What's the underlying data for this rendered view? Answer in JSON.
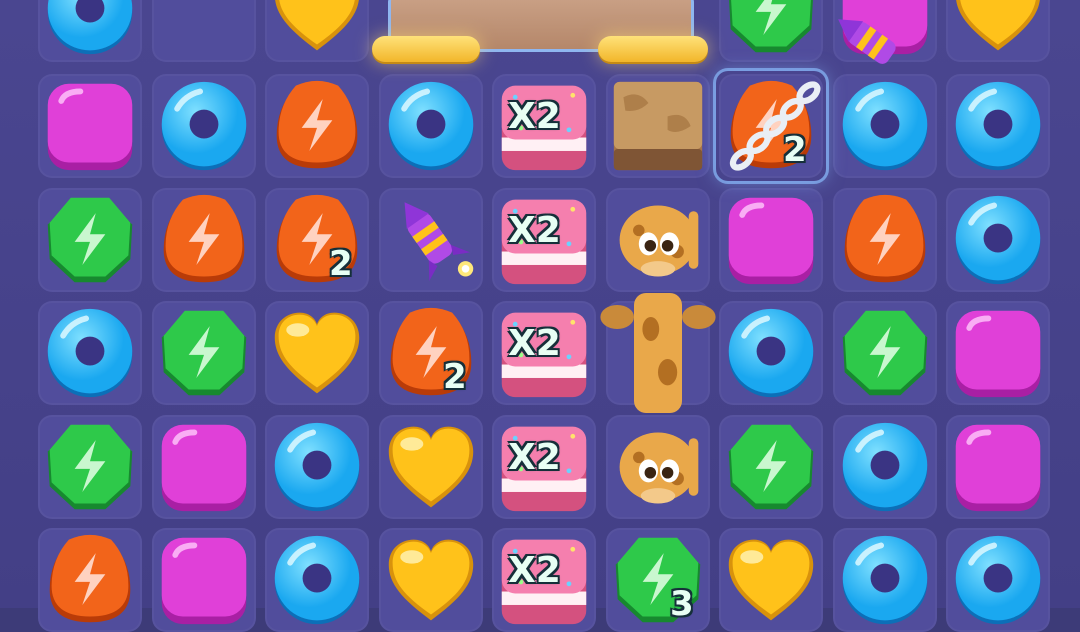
{
  "board": {
    "cells": [
      {
        "c": 0,
        "r": 0,
        "type": "donut"
      },
      {
        "c": 1,
        "r": 0,
        "type": "empty"
      },
      {
        "c": 2,
        "r": 0,
        "type": "heart"
      },
      {
        "c": 3,
        "r": 0,
        "type": "chute"
      },
      {
        "c": 4,
        "r": 0,
        "type": "chute"
      },
      {
        "c": 5,
        "r": 0,
        "type": "chute"
      },
      {
        "c": 6,
        "r": 0,
        "type": "bolt-green"
      },
      {
        "c": 7,
        "r": 0,
        "type": "square"
      },
      {
        "c": 8,
        "r": 0,
        "type": "heart"
      },
      {
        "c": 0,
        "r": 1,
        "type": "square"
      },
      {
        "c": 1,
        "r": 1,
        "type": "donut"
      },
      {
        "c": 2,
        "r": 1,
        "type": "bolt-orange"
      },
      {
        "c": 3,
        "r": 1,
        "type": "donut"
      },
      {
        "c": 4,
        "r": 1,
        "type": "cake"
      },
      {
        "c": 5,
        "r": 1,
        "type": "crate"
      },
      {
        "c": 6,
        "r": 1,
        "type": "bolt-orange",
        "chain": true,
        "badge": "2"
      },
      {
        "c": 7,
        "r": 1,
        "type": "donut"
      },
      {
        "c": 8,
        "r": 1,
        "type": "donut"
      },
      {
        "c": 0,
        "r": 2,
        "type": "bolt-green"
      },
      {
        "c": 1,
        "r": 2,
        "type": "bolt-orange"
      },
      {
        "c": 2,
        "r": 2,
        "type": "bolt-orange",
        "badge": "2"
      },
      {
        "c": 3,
        "r": 2,
        "type": "rocket"
      },
      {
        "c": 4,
        "r": 2,
        "type": "cake"
      },
      {
        "c": 5,
        "r": 2,
        "type": "giraffe"
      },
      {
        "c": 6,
        "r": 2,
        "type": "square"
      },
      {
        "c": 7,
        "r": 2,
        "type": "bolt-orange"
      },
      {
        "c": 8,
        "r": 2,
        "type": "donut"
      },
      {
        "c": 0,
        "r": 3,
        "type": "donut"
      },
      {
        "c": 1,
        "r": 3,
        "type": "bolt-green"
      },
      {
        "c": 2,
        "r": 3,
        "type": "heart"
      },
      {
        "c": 3,
        "r": 3,
        "type": "bolt-orange",
        "badge": "2"
      },
      {
        "c": 4,
        "r": 3,
        "type": "cake"
      },
      {
        "c": 5,
        "r": 3,
        "type": "giraffe-neck"
      },
      {
        "c": 6,
        "r": 3,
        "type": "donut"
      },
      {
        "c": 7,
        "r": 3,
        "type": "bolt-green"
      },
      {
        "c": 8,
        "r": 3,
        "type": "square"
      },
      {
        "c": 0,
        "r": 4,
        "type": "bolt-green"
      },
      {
        "c": 1,
        "r": 4,
        "type": "square"
      },
      {
        "c": 2,
        "r": 4,
        "type": "donut"
      },
      {
        "c": 3,
        "r": 4,
        "type": "heart"
      },
      {
        "c": 4,
        "r": 4,
        "type": "cake"
      },
      {
        "c": 5,
        "r": 4,
        "type": "giraffe"
      },
      {
        "c": 6,
        "r": 4,
        "type": "bolt-green"
      },
      {
        "c": 7,
        "r": 4,
        "type": "donut"
      },
      {
        "c": 8,
        "r": 4,
        "type": "square"
      },
      {
        "c": 0,
        "r": 5,
        "type": "bolt-orange"
      },
      {
        "c": 1,
        "r": 5,
        "type": "square"
      },
      {
        "c": 2,
        "r": 5,
        "type": "donut"
      },
      {
        "c": 3,
        "r": 5,
        "type": "heart"
      },
      {
        "c": 4,
        "r": 5,
        "type": "cake"
      },
      {
        "c": 5,
        "r": 5,
        "type": "bolt-green",
        "badge": "3"
      },
      {
        "c": 6,
        "r": 5,
        "type": "heart"
      },
      {
        "c": 7,
        "r": 5,
        "type": "donut"
      },
      {
        "c": 8,
        "r": 5,
        "type": "donut"
      }
    ],
    "extra_pieces": [
      {
        "type": "rocket-falling"
      }
    ]
  },
  "labels": {
    "cake_multiplier": "X2"
  },
  "colors": {
    "donut": "#1aa8f0",
    "heart": "#ffc21a",
    "square": "#e040d8",
    "bolt_green": "#2ec94a",
    "bolt_orange": "#f2641a",
    "cake": "#f57fae",
    "crate": "#c79a63"
  }
}
